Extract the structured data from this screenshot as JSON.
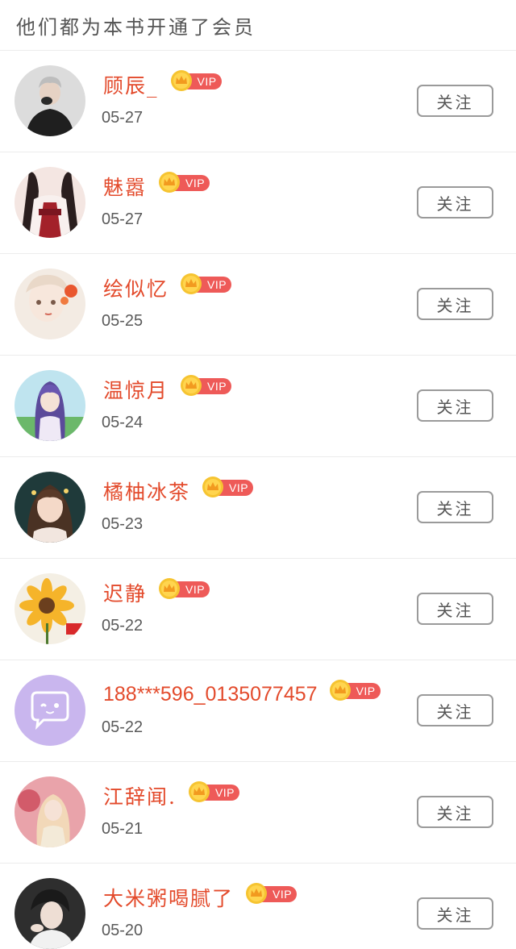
{
  "header": {
    "title": "他们都为本书开通了会员"
  },
  "vip_label": "VIP",
  "colors": {
    "name": "#e34a2b",
    "vip_tag": "#ee5a58",
    "crown": "#f6c431",
    "divider": "#ececec",
    "button_border": "#9a9a9a"
  },
  "members": [
    {
      "name": "顾辰_",
      "date": "05-27",
      "follow_label": "关注",
      "avatar_icon": "person-black-outfit-avatar"
    },
    {
      "name": "魅嚣",
      "date": "05-27",
      "follow_label": "关注",
      "avatar_icon": "hanfu-girl-avatar"
    },
    {
      "name": "绘似忆",
      "date": "05-25",
      "follow_label": "关注",
      "avatar_icon": "illustrated-girl-avatar"
    },
    {
      "name": "温惊月",
      "date": "05-24",
      "follow_label": "关注",
      "avatar_icon": "anime-girl-avatar"
    },
    {
      "name": "橘柚冰茶",
      "date": "05-23",
      "follow_label": "关注",
      "avatar_icon": "girl-photo-avatar"
    },
    {
      "name": "迟静",
      "date": "05-22",
      "follow_label": "关注",
      "avatar_icon": "sunflower-avatar"
    },
    {
      "name": "188***596_0135077457",
      "date": "05-22",
      "follow_label": "关注",
      "avatar_icon": "default-chat-bubble-avatar"
    },
    {
      "name": "江辞闻.",
      "date": "05-21",
      "follow_label": "关注",
      "avatar_icon": "pink-girl-avatar"
    },
    {
      "name": "大米粥喝腻了",
      "date": "05-20",
      "follow_label": "关注",
      "avatar_icon": "boy-photo-avatar"
    }
  ]
}
